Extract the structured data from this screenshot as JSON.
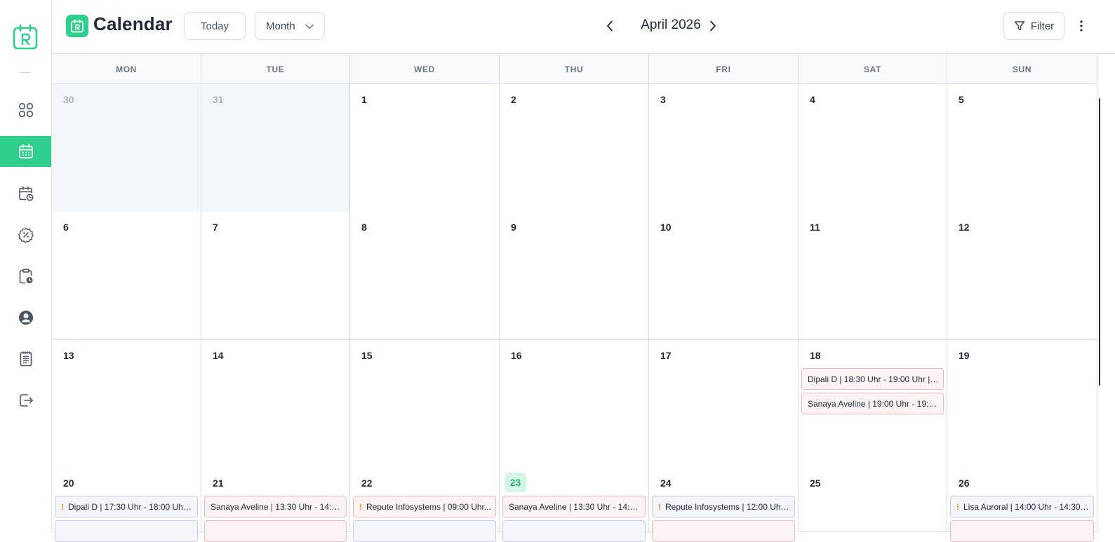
{
  "app": {
    "title": "Calendar"
  },
  "toolbar": {
    "today_label": "Today",
    "view_label": "Month",
    "period_label": "April 2026",
    "filter_label": "Filter"
  },
  "colors": {
    "accent": "#2ecf8a",
    "today_bg": "#d7f5e6",
    "event_pink_border": "#f2b8c1",
    "event_blue_border": "#c5cae8",
    "warning": "#e89b0c"
  },
  "sidebar": {
    "items": [
      {
        "icon": "dashboard-icon",
        "active": false
      },
      {
        "icon": "calendar-icon",
        "active": true
      },
      {
        "icon": "calendar-clock-icon",
        "active": false
      },
      {
        "icon": "discount-badge-icon",
        "active": false
      },
      {
        "icon": "clipboard-clock-icon",
        "active": false
      },
      {
        "icon": "user-circle-icon",
        "active": false
      },
      {
        "icon": "document-list-icon",
        "active": false
      },
      {
        "icon": "logout-icon",
        "active": false
      }
    ]
  },
  "weekdays": [
    "MON",
    "TUE",
    "WED",
    "THU",
    "FRI",
    "SAT",
    "SUN"
  ],
  "weeks": [
    [
      {
        "day": "30",
        "outside": true,
        "events": []
      },
      {
        "day": "31",
        "outside": true,
        "events": []
      },
      {
        "day": "1",
        "events": []
      },
      {
        "day": "2",
        "events": []
      },
      {
        "day": "3",
        "events": []
      },
      {
        "day": "4",
        "events": []
      },
      {
        "day": "5",
        "events": []
      }
    ],
    [
      {
        "day": "6",
        "events": []
      },
      {
        "day": "7",
        "events": []
      },
      {
        "day": "8",
        "events": []
      },
      {
        "day": "9",
        "events": []
      },
      {
        "day": "10",
        "events": []
      },
      {
        "day": "11",
        "events": []
      },
      {
        "day": "12",
        "events": []
      }
    ],
    [
      {
        "day": "13",
        "events": []
      },
      {
        "day": "14",
        "events": []
      },
      {
        "day": "15",
        "events": []
      },
      {
        "day": "16",
        "events": []
      },
      {
        "day": "17",
        "events": []
      },
      {
        "day": "18",
        "events": [
          {
            "text": "Dipali D | 18:30 Uhr - 19:00 Uhr | S...",
            "style": "pink",
            "warning": false
          },
          {
            "text": "Sanaya Aveline | 19:00 Uhr - 19:3...",
            "style": "pink",
            "warning": false
          }
        ]
      },
      {
        "day": "19",
        "events": []
      }
    ],
    [
      {
        "day": "20",
        "events": [
          {
            "text": "Dipali D | 17:30 Uhr - 18:00 Uhr | ...",
            "style": "blue",
            "warning": true
          },
          {
            "text": "",
            "style": "blue",
            "warning": false
          }
        ]
      },
      {
        "day": "21",
        "events": [
          {
            "text": "Sanaya Aveline | 13:30 Uhr - 14:0...",
            "style": "pink",
            "warning": false
          },
          {
            "text": "",
            "style": "pink",
            "warning": false
          }
        ]
      },
      {
        "day": "22",
        "events": [
          {
            "text": "Repute Infosystems | 09:00 Uhr...",
            "style": "pink",
            "warning": true
          },
          {
            "text": "",
            "style": "blue",
            "warning": false
          }
        ]
      },
      {
        "day": "23",
        "today": true,
        "events": [
          {
            "text": "Sanaya Aveline | 13:30 Uhr - 14:0...",
            "style": "pink",
            "warning": false
          },
          {
            "text": "",
            "style": "blue",
            "warning": false
          }
        ]
      },
      {
        "day": "24",
        "events": [
          {
            "text": "Repute Infosystems | 12:00 Uhr ...",
            "style": "blue",
            "warning": true
          },
          {
            "text": "",
            "style": "pink",
            "warning": false
          }
        ]
      },
      {
        "day": "25",
        "events": []
      },
      {
        "day": "26",
        "events": [
          {
            "text": "Lisa Auroral | 14:00 Uhr - 14:30 ...",
            "style": "blue",
            "warning": true
          },
          {
            "text": "",
            "style": "pink",
            "warning": false
          }
        ]
      }
    ]
  ]
}
